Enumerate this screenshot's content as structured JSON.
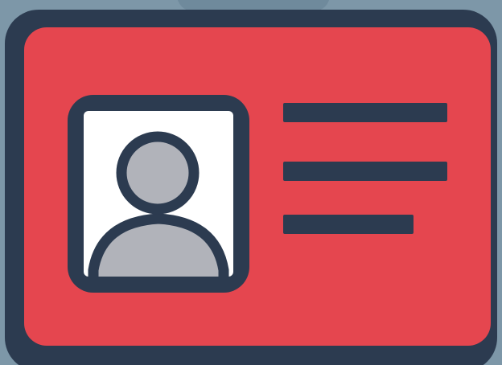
{
  "icon": {
    "name": "id-card-icon",
    "parts": {
      "card": "card-icon",
      "photo": "user-avatar-icon",
      "text_lines": [
        "text-line-placeholder",
        "text-line-placeholder",
        "text-line-placeholder"
      ]
    }
  },
  "colors": {
    "background": "#7d97a8",
    "top_tab": "#6f8a9c",
    "outline": "#2c3b50",
    "card_fill": "#e5464f",
    "photo_background": "#ffffff",
    "avatar_fill": "#b1b3ba",
    "text_lines": "#2c3b50"
  }
}
